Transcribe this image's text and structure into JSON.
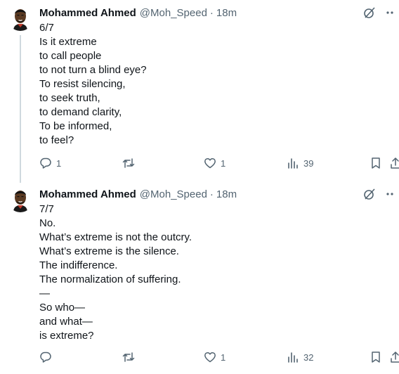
{
  "tweets": [
    {
      "author_name": "Mohammed Ahmed",
      "handle": "@Moh_Speed",
      "separator": "·",
      "time": "18m",
      "lines": [
        "6/7",
        "Is it extreme",
        "to call people",
        "to not turn a blind eye?",
        "To resist silencing,",
        "to seek truth,",
        "to demand clarity,",
        "To be informed,",
        "to feel?"
      ],
      "reply_count": "1",
      "retweet_count": "",
      "like_count": "1",
      "view_count": "39"
    },
    {
      "author_name": "Mohammed Ahmed",
      "handle": "@Moh_Speed",
      "separator": "·",
      "time": "18m",
      "lines": [
        "7/7",
        "No.",
        "What’s extreme is not the outcry.",
        "What’s extreme is the silence.",
        "The indifference.",
        "The normalization of suffering.",
        "—",
        "So who—",
        "and what—",
        "is extreme?"
      ],
      "reply_count": "",
      "retweet_count": "",
      "like_count": "1",
      "view_count": "32"
    }
  ],
  "icons": {
    "reply": "reply-icon",
    "retweet": "retweet-icon",
    "like": "heart-icon",
    "views": "views-icon",
    "bookmark": "bookmark-icon",
    "share": "share-icon",
    "grok": "grok-icon",
    "more": "more-icon"
  },
  "colors": {
    "text": "#0f1419",
    "secondary": "#536471",
    "thread_line": "#cfd9de"
  }
}
